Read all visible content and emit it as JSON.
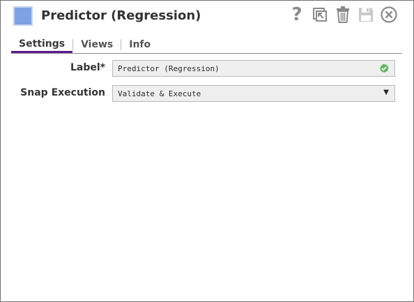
{
  "window": {
    "title": "Predictor (Regression)",
    "accent_color": "#7ea1e6",
    "tab_accent_color": "#5b1a8e"
  },
  "toolbar": {
    "help_glyph": "?",
    "icons": [
      "help-icon",
      "export-icon",
      "delete-icon",
      "save-icon",
      "close-icon"
    ]
  },
  "tabs": [
    {
      "label": "Settings",
      "active": true
    },
    {
      "label": "Views",
      "active": false
    },
    {
      "label": "Info",
      "active": false
    }
  ],
  "form": {
    "label_field": {
      "label": "Label*",
      "value": "Predictor (Regression)",
      "status_icon": "valid-check-icon",
      "status_color": "#5cb85c"
    },
    "snap_execution": {
      "label": "Snap Execution",
      "selected": "Validate & Execute",
      "caret": "▼"
    }
  }
}
